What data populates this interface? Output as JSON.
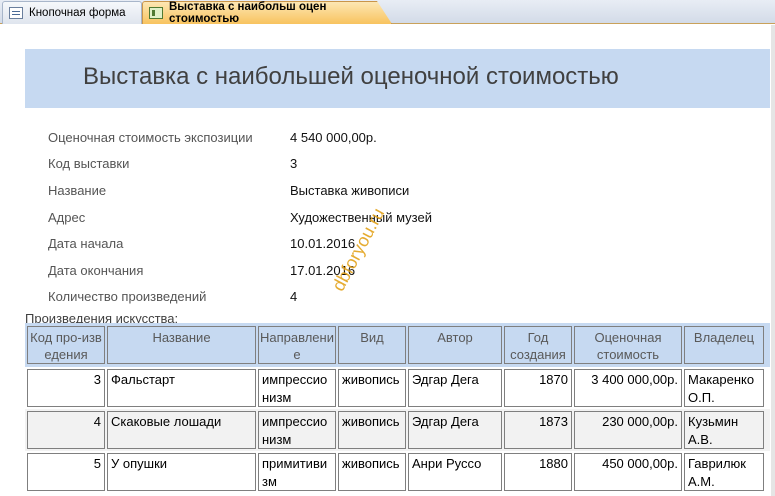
{
  "tabs": [
    {
      "label": "Кнопочная форма",
      "icon": "form-icon"
    },
    {
      "label": "Выставка с наибольш оцен стоимостью",
      "icon": "report-icon",
      "active": true
    }
  ],
  "report": {
    "title": "Выставка с наибольшей оценочной стоимостью",
    "fields": [
      {
        "label": "Оценочная стоимость экспозиции",
        "value": "4 540 000,00р."
      },
      {
        "label": "Код выставки",
        "value": "3"
      },
      {
        "label": "Название",
        "value": "Выставка живописи"
      },
      {
        "label": "Адрес",
        "value": "Художественный музей"
      },
      {
        "label": "Дата начала",
        "value": "10.01.2016"
      },
      {
        "label": "Дата окончания",
        "value": "17.01.2016"
      },
      {
        "label": "Количество произведений",
        "value": "4"
      }
    ],
    "subform_label": "Произведения искусства:",
    "columns": [
      "Код про-изведения",
      "Название",
      "Направление",
      "Вид",
      "Автор",
      "Год создания",
      "Оценочная стоимость",
      "Владелец"
    ],
    "rows": [
      [
        "3",
        "Фальстарт",
        "импрессионизм",
        "живопись",
        "Эдгар Дега",
        "1870",
        "3 400 000,00р.",
        "Макаренко О.П."
      ],
      [
        "4",
        "Скаковые лошади",
        "импрессионизм",
        "живопись",
        "Эдгар Дега",
        "1873",
        "230 000,00р.",
        "Кузьмин А.В."
      ],
      [
        "5",
        "У опушки",
        "примитивизм",
        "живопись",
        "Анри Руссо",
        "1880",
        "450 000,00р.",
        "Гаврилюк А.М."
      ]
    ]
  },
  "watermark": "dbforyou.ru",
  "colors": {
    "header_band": "#c6d9f1",
    "active_tab": "#f8c35f",
    "watermark": "#e3a21a"
  }
}
